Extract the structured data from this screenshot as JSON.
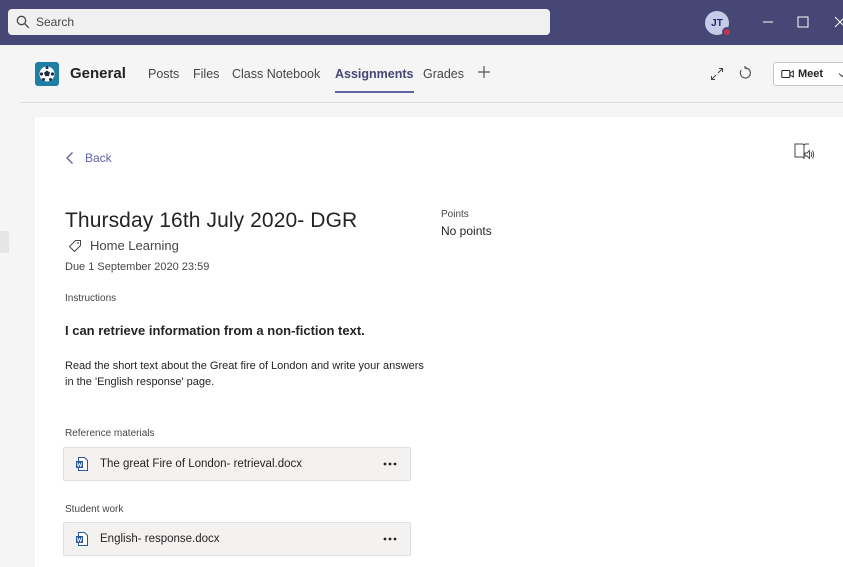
{
  "titlebar": {
    "search_placeholder": "Search",
    "avatar_initials": "JT"
  },
  "channel": {
    "name": "General",
    "tabs": [
      {
        "label": "Posts"
      },
      {
        "label": "Files"
      },
      {
        "label": "Class Notebook"
      },
      {
        "label": "Assignments"
      },
      {
        "label": "Grades"
      }
    ],
    "meet_label": "Meet"
  },
  "assignment": {
    "back_label": "Back",
    "title": "Thursday 16th July 2020- DGR",
    "category": "Home Learning",
    "due": "Due 1 September 2020 23:59",
    "points_label": "Points",
    "points_value": "No points",
    "instructions_label": "Instructions",
    "instruction_heading": "I can retrieve information from a non-fiction text.",
    "instruction_body": "Read the short text about the Great fire of London and write your answers in the 'English response' page.",
    "reference_label": "Reference materials",
    "reference_files": [
      {
        "name": "The great Fire of London- retrieval.docx"
      }
    ],
    "student_work_label": "Student work",
    "student_files": [
      {
        "name": "English- response.docx"
      }
    ]
  },
  "colors": {
    "titlebar": "#464775",
    "accent": "#6264a7",
    "team_logo": "#1f7fa3",
    "presence_busy": "#c4314b",
    "word_blue": "#2b579a"
  }
}
